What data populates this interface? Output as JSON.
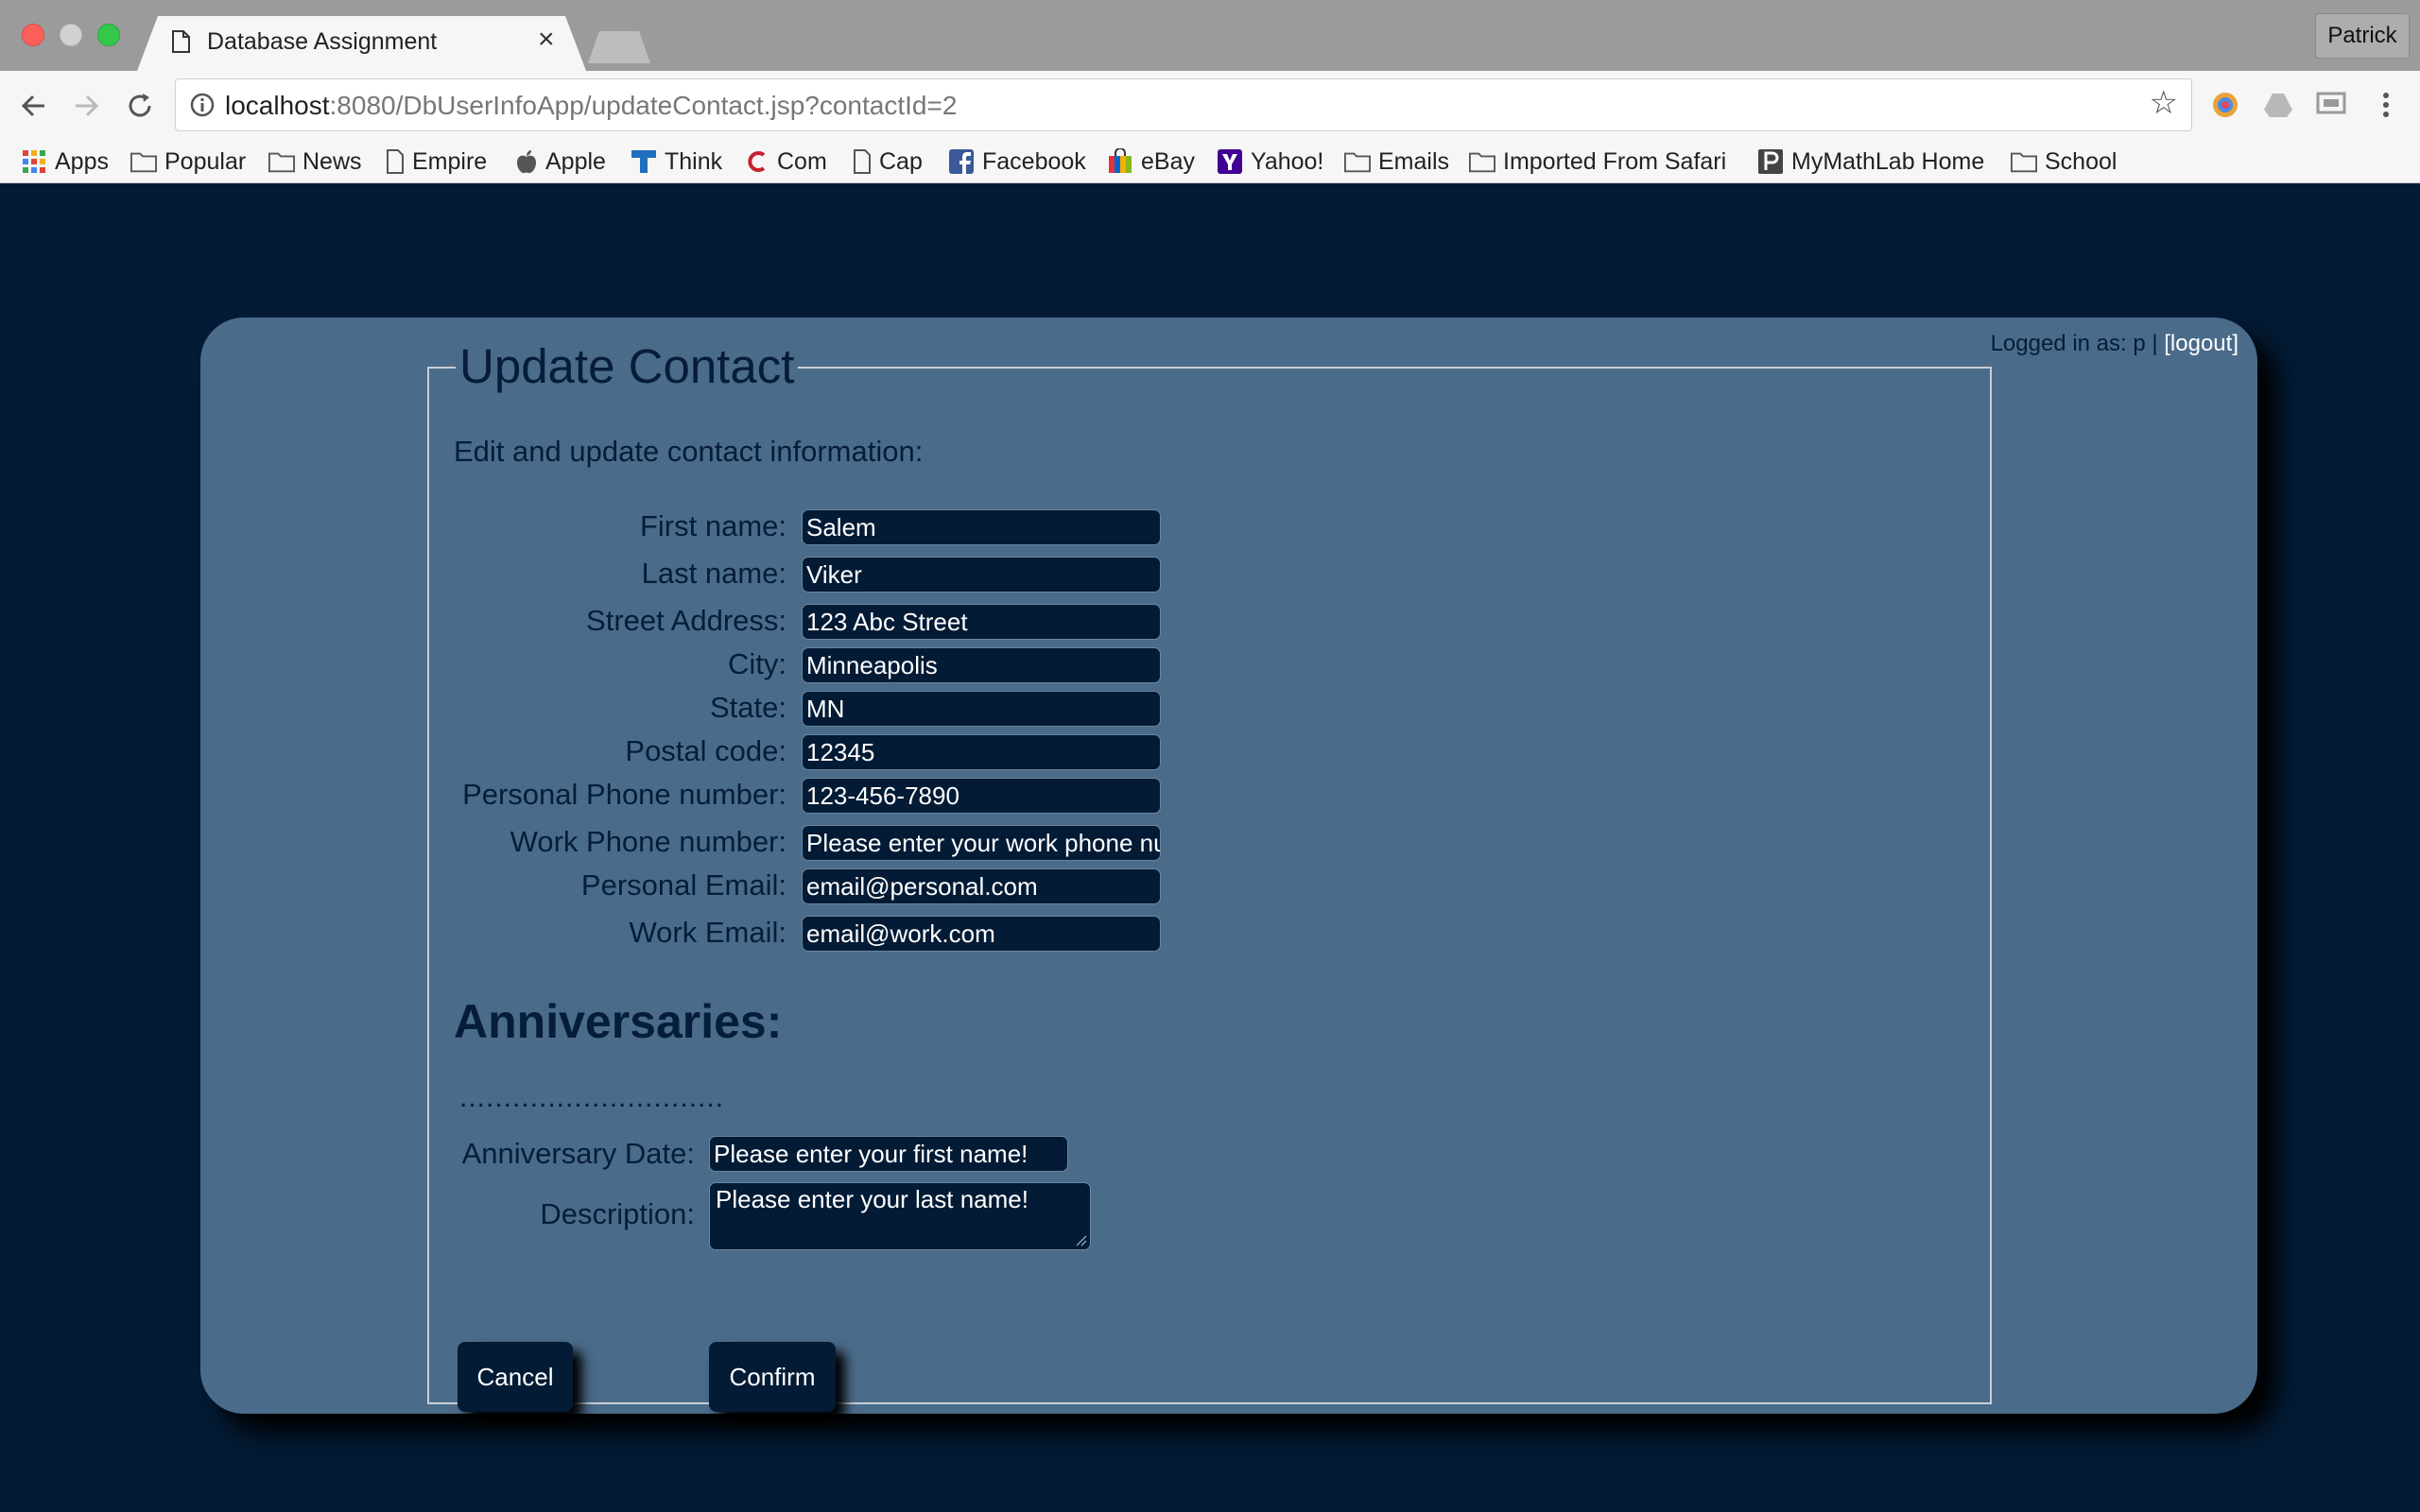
{
  "browser": {
    "tab_title": "Database Assignment",
    "tab_close": "×",
    "profile_name": "Patrick",
    "url_host": "localhost",
    "url_rest": ":8080/DbUserInfoApp/updateContact.jsp?contactId=2",
    "bookmarks": [
      "Apps",
      "Popular",
      "News",
      "Empire",
      "Apple",
      "Think",
      "Com",
      "Cap",
      "Facebook",
      "eBay",
      "Yahoo!",
      "Emails",
      "Imported From Safari",
      "MyMathLab Home",
      "School"
    ]
  },
  "header": {
    "login_text": "Logged in as: p | ",
    "logout_label": "[logout]"
  },
  "form": {
    "title": "Update Contact",
    "intro": "Edit and update contact information:",
    "fields": [
      {
        "label": "First name:",
        "value": "Salem"
      },
      {
        "label": "Last name:",
        "value": "Viker"
      },
      {
        "label": "Street Address:",
        "value": "123 Abc Street"
      },
      {
        "label": "City:",
        "value": "Minneapolis"
      },
      {
        "label": "State:",
        "value": "MN"
      },
      {
        "label": "Postal code:",
        "value": "12345"
      },
      {
        "label": "Personal Phone number:",
        "value": "123-456-7890"
      },
      {
        "label": "Work Phone number:",
        "value": "Please enter your work phone nu"
      },
      {
        "label": "Personal Email:",
        "value": "email@personal.com"
      },
      {
        "label": "Work Email:",
        "value": "email@work.com"
      }
    ]
  },
  "anniversaries": {
    "heading": "Anniversaries:",
    "dots": "..............................",
    "date_label": "Anniversary Date:",
    "date_value": "Please enter your first name!",
    "desc_label": "Description:",
    "desc_value": "Please enter your last name!"
  },
  "buttons": {
    "cancel": "Cancel",
    "confirm": "Confirm"
  },
  "colors": {
    "page_bg": "#031b35",
    "panel_bg": "#4a6b8a",
    "text": "#061d39",
    "input_bg": "#031b35"
  }
}
